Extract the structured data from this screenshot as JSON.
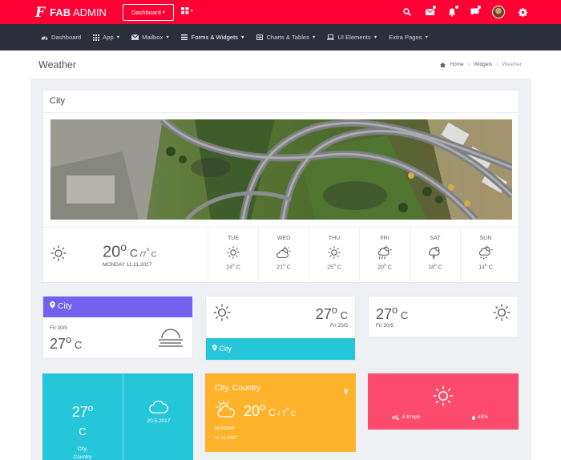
{
  "brand": {
    "logo_mark": "F",
    "name_bold": "FAB",
    "name_rest": " ADMIN"
  },
  "topbar": {
    "dashboard_label": "Dashboard",
    "dashboard_caret": "▾",
    "apps_caret": "▾"
  },
  "nav": {
    "items": [
      {
        "label": "Dashboard",
        "icon": "speedometer-icon",
        "caret": ""
      },
      {
        "label": "App",
        "icon": "grid-icon",
        "caret": "▼"
      },
      {
        "label": "Mailbox",
        "icon": "mail-icon",
        "caret": "▼"
      },
      {
        "label": "Forms & Widgets",
        "icon": "list-icon",
        "caret": "▼"
      },
      {
        "label": "Charts & Tables",
        "icon": "table-icon",
        "caret": "▼"
      },
      {
        "label": "UI Elements",
        "icon": "laptop-icon",
        "caret": "▼"
      },
      {
        "label": "Extra Pages",
        "icon": "",
        "caret": "▼"
      }
    ]
  },
  "page": {
    "title": "Weather",
    "breadcrumb": [
      "Home",
      "Widgets",
      "Weather"
    ]
  },
  "city_card": {
    "title": "City",
    "current": {
      "temp": "20",
      "deg": "o",
      "unit": " C",
      "low": " /7",
      "low_deg": "o",
      "low_unit": " C",
      "date": "MONDAY 11.11.2017"
    },
    "days": [
      {
        "name": "TUE",
        "icon": "sun-icon",
        "temp": "24",
        "deg": "o",
        "unit": " C"
      },
      {
        "name": "WED",
        "icon": "cloudy-sun-icon",
        "temp": "21",
        "deg": "o",
        "unit": " C"
      },
      {
        "name": "THU",
        "icon": "sun-icon",
        "temp": "25",
        "deg": "o",
        "unit": " C"
      },
      {
        "name": "FRI",
        "icon": "sun-rain-icon",
        "temp": "20",
        "deg": "o",
        "unit": " C"
      },
      {
        "name": "SAT",
        "icon": "storm-icon",
        "temp": "18",
        "deg": "o",
        "unit": " C"
      },
      {
        "name": "SUN",
        "icon": "cloud-snow-icon",
        "temp": "14",
        "deg": "o",
        "unit": " C"
      }
    ]
  },
  "widget1": {
    "city": "City",
    "date": "Fri 20/5",
    "temp": "27",
    "deg": "o",
    "unit": " C",
    "color": "#7460ee"
  },
  "widget2": {
    "city": "City",
    "date": "Fri 20/5",
    "temp": "27",
    "deg": "o",
    "unit": " C",
    "color": "#26c6da"
  },
  "widget3": {
    "date": "Fri 20/5",
    "temp": "27",
    "deg": "o",
    "unit": " C"
  },
  "widget4": {
    "temp": "27",
    "deg": "o",
    "unit": "C",
    "city_line1": "City,",
    "city_line2": "Country",
    "date": "20.5.2017",
    "color": "#26c6da"
  },
  "widget5": {
    "title": "City, Country",
    "temp": "20",
    "deg": "o",
    "unit": " C",
    "low": " / 7",
    "low_deg": "o",
    "low_unit": " C",
    "day": "MONDAY",
    "date": "11.11.2017",
    "color": "#ffb22b"
  },
  "widget6": {
    "wind": "8 Kmph",
    "humidity": "40%",
    "color": "#fc4b6c"
  },
  "colors": {
    "topbar": "#ff0035",
    "navbar": "#2a2f3b"
  }
}
